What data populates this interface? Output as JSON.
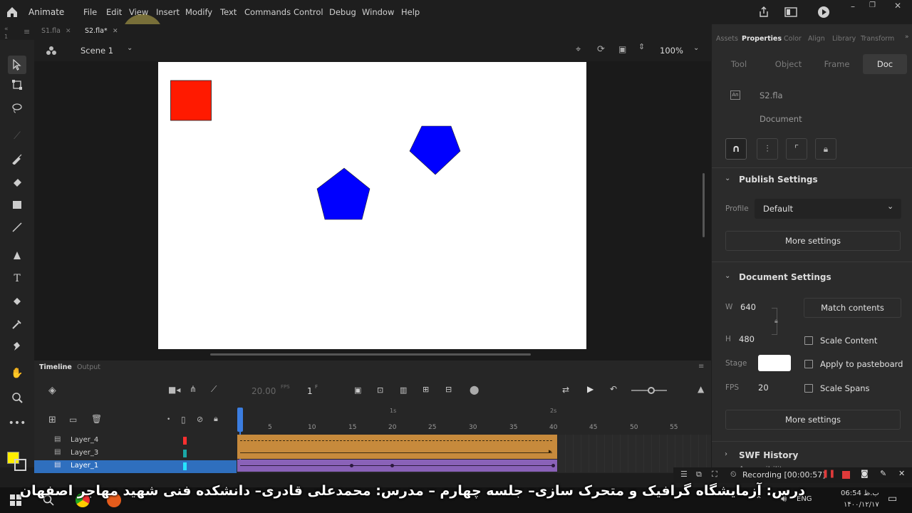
{
  "app": {
    "name": "Animate",
    "menus": [
      "File",
      "Edit",
      "View",
      "Insert",
      "Modify",
      "Text",
      "Commands",
      "Control",
      "Debug",
      "Window",
      "Help"
    ]
  },
  "tabs": [
    {
      "label": "S1.fla",
      "active": false
    },
    {
      "label": "S2.fla*",
      "active": true
    }
  ],
  "scene": {
    "label": "Scene 1",
    "zoom": "100%"
  },
  "stage": {
    "background": "#ffffff",
    "rect_color": "#ff1a00",
    "pentagon_color": "#0000ff"
  },
  "panel": {
    "tabs": [
      "Assets",
      "Properties",
      "Color",
      "Align",
      "Library",
      "Transform"
    ],
    "active_tab": "Properties",
    "segments": [
      "Tool",
      "Object",
      "Frame",
      "Doc"
    ],
    "active_segment": "Doc",
    "doc_name": "S2.fla",
    "doc_type": "Document",
    "publish": {
      "header": "Publish Settings",
      "profile_label": "Profile",
      "profile_value": "Default",
      "more_settings": "More settings"
    },
    "document": {
      "header": "Document Settings",
      "w_label": "W",
      "w_value": "640",
      "h_label": "H",
      "h_value": "480",
      "match_contents": "Match contents",
      "scale_content": "Scale Content",
      "stage_label": "Stage",
      "apply_pasteboard": "Apply to pasteboard",
      "fps_label": "FPS",
      "fps_value": "20",
      "scale_spans": "Scale Spans",
      "more_settings": "More settings"
    },
    "swf_history": "SWF History",
    "accessibility": "Accessibility"
  },
  "timeline": {
    "tabs": [
      "Timeline",
      "Output"
    ],
    "fps_display": "20.00",
    "fps_unit": "FPS",
    "frame_display": "1",
    "frame_unit": "F",
    "ruler": [
      "5",
      "10",
      "15",
      "20",
      "25",
      "30",
      "35",
      "40",
      "45",
      "50",
      "55"
    ],
    "seconds": [
      "1s",
      "2s"
    ],
    "layers": [
      {
        "name": "Layer_4",
        "color": "#ff3030",
        "selected": false
      },
      {
        "name": "Layer_3",
        "color": "#1aa7a7",
        "selected": false
      },
      {
        "name": "Layer_1",
        "color": "#27e4ff",
        "selected": true
      }
    ]
  },
  "recording": {
    "label": "Recording [00:00:57]"
  },
  "subtitle": "درس: آزمایشگاه گرافیک و متحرک سازی– جلسه چهارم – مدرس: محمدعلی قادری– دانشکده فنی شهید مهاجر اصفهان",
  "taskbar": {
    "lang": "ENG",
    "time": "06:54 ب.ظ",
    "date": "۱۴۰۰/۱۲/۱۷"
  }
}
